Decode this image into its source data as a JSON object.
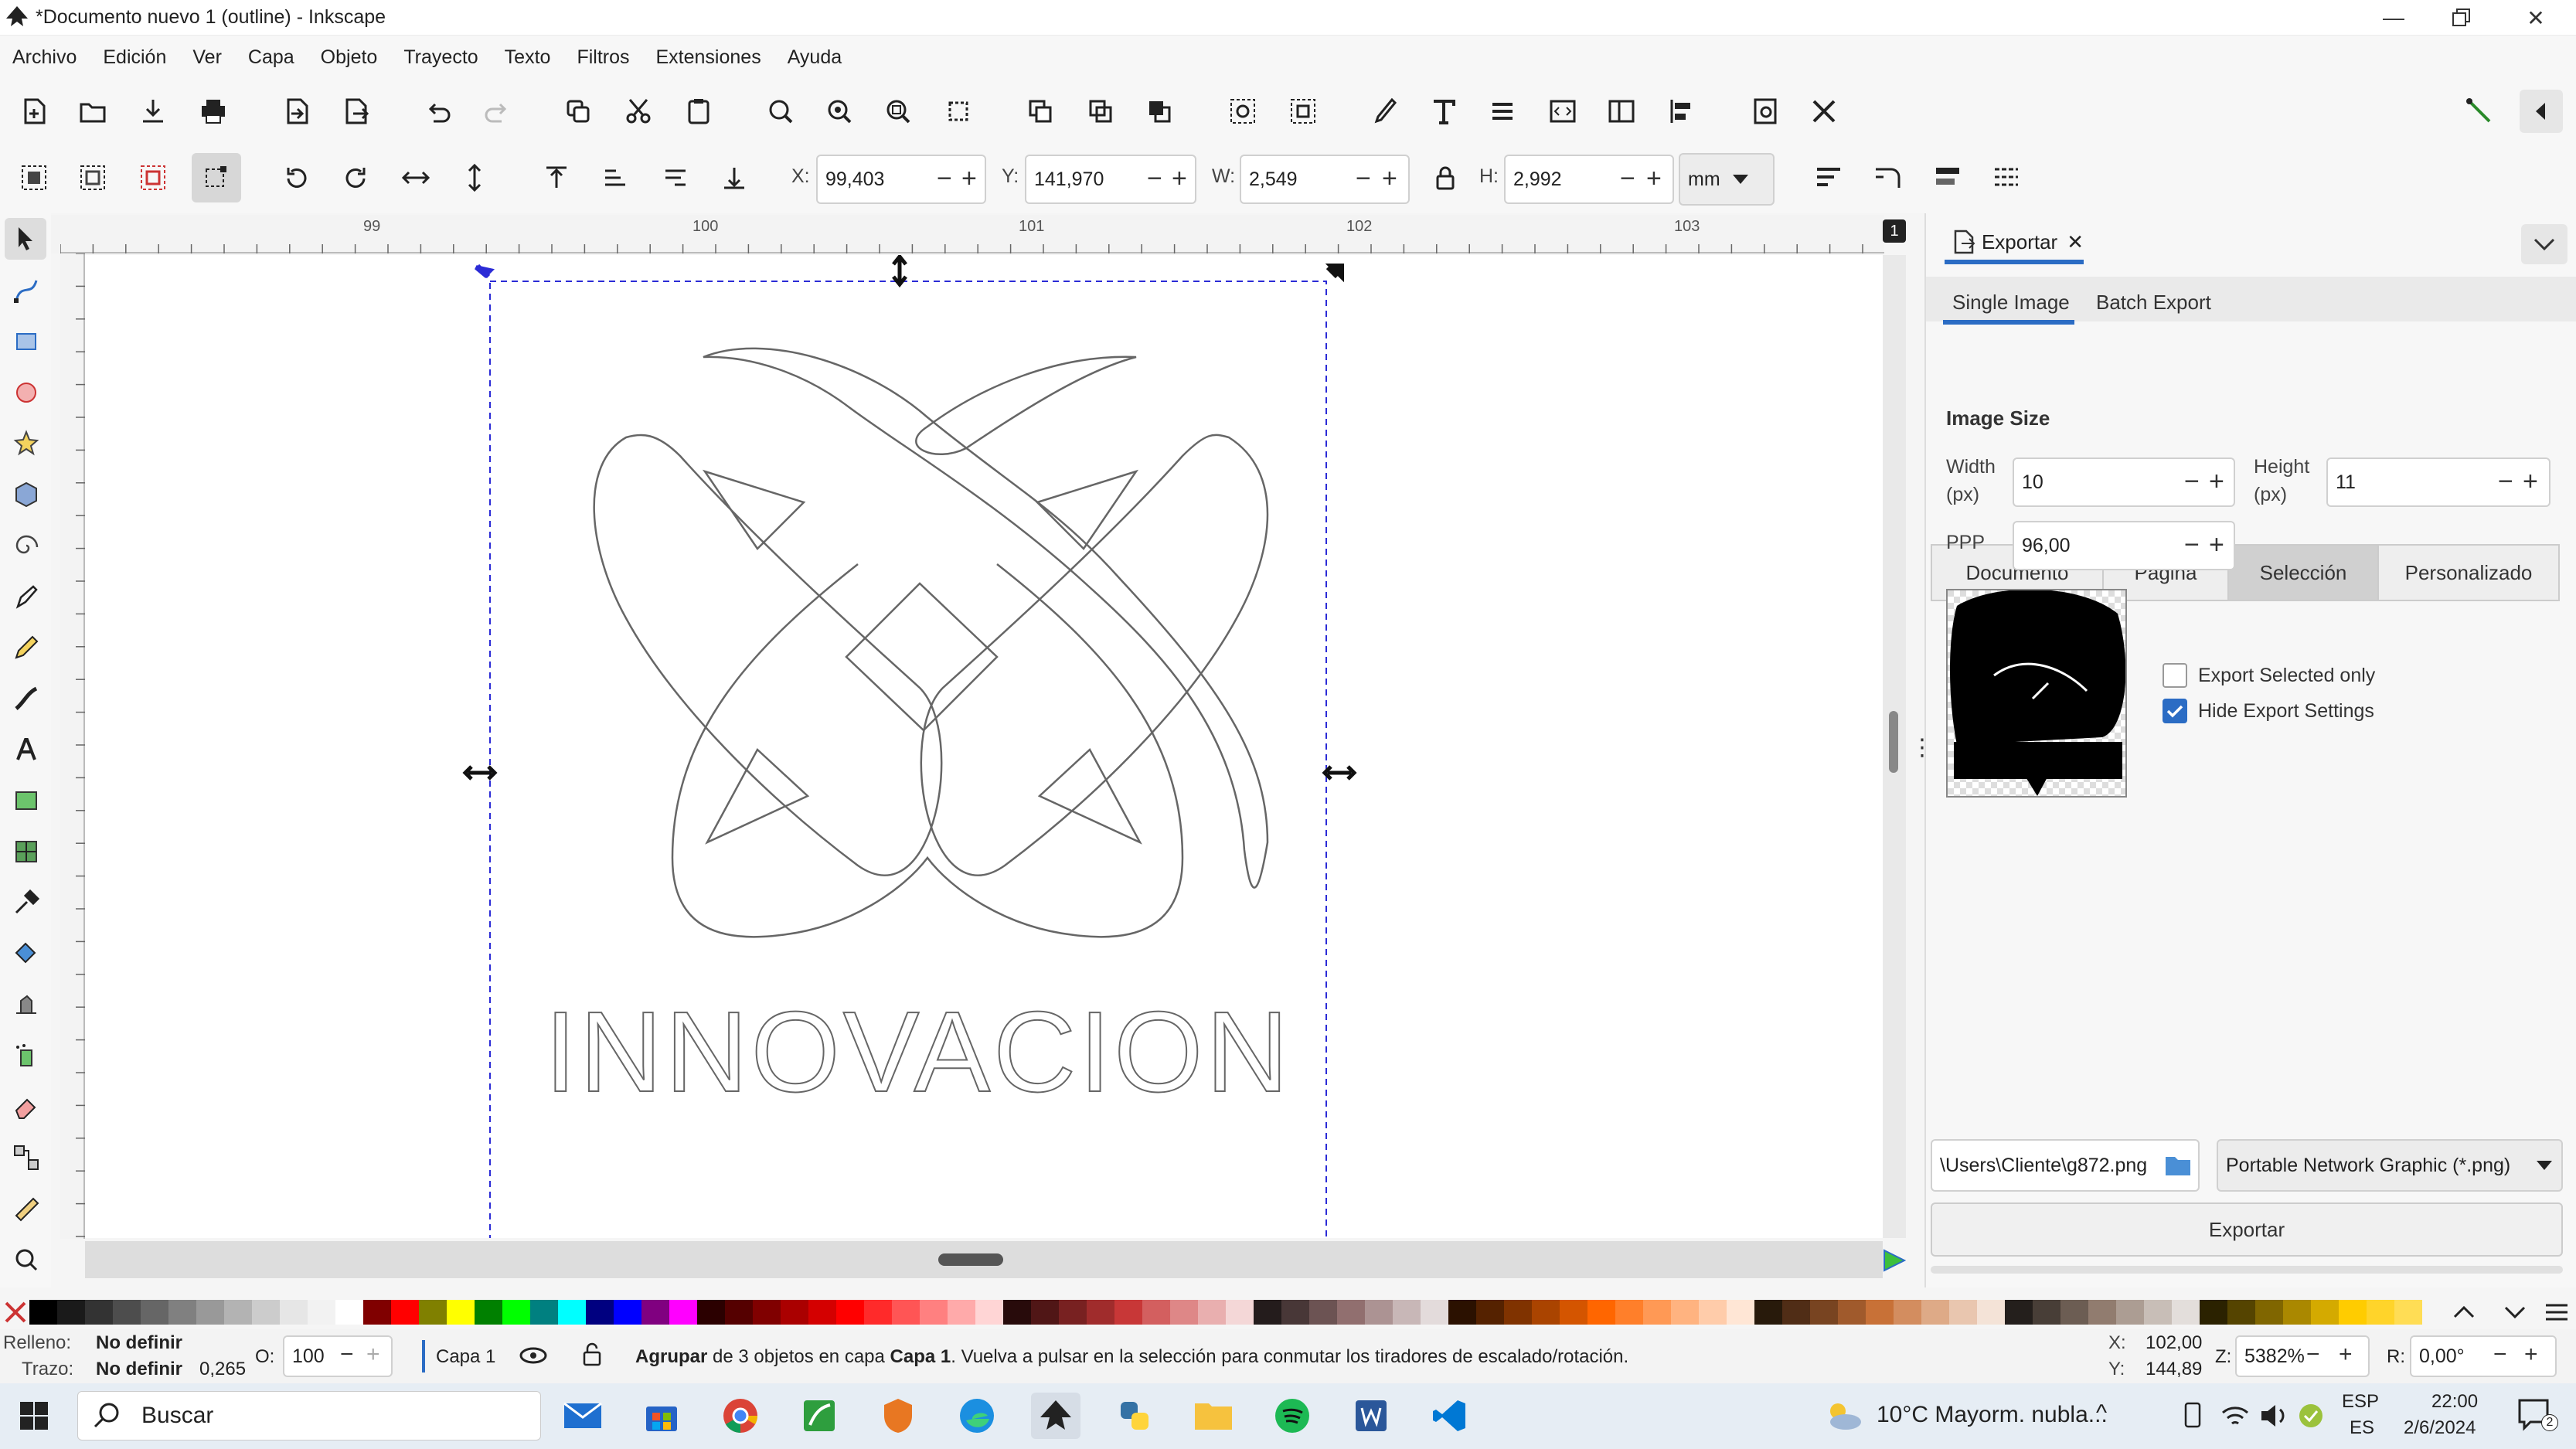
{
  "window": {
    "title": "*Documento nuevo 1 (outline) - Inkscape"
  },
  "menu": [
    "Archivo",
    "Edición",
    "Ver",
    "Capa",
    "Objeto",
    "Trayecto",
    "Texto",
    "Filtros",
    "Extensiones",
    "Ayuda"
  ],
  "coords": {
    "x_label": "X:",
    "x": "99,403",
    "y_label": "Y:",
    "y": "141,970",
    "w_label": "W:",
    "w": "2,549",
    "h_label": "H:",
    "h": "2,992",
    "unit": "mm"
  },
  "ruler": {
    "t1": "99",
    "t2": "100",
    "t3": "101",
    "t4": "102",
    "t5": "103",
    "layer_badge": "1"
  },
  "canvas": {
    "logo_text": "INNOVACION"
  },
  "export": {
    "tab_title": "Exportar",
    "subtab_single": "Single Image",
    "subtab_batch": "Batch Export",
    "area_buttons": [
      "Documento",
      "Página",
      "Selección",
      "Personalizado"
    ],
    "image_size": "Image Size",
    "width_label": "Width",
    "height_label": "Height",
    "px": "(px)",
    "width": "10",
    "height": "11",
    "ppp_label": "PPP",
    "ppp": "96,00",
    "export_selected_only": "Export Selected only",
    "hide_export_settings": "Hide Export Settings",
    "hide_checked": true,
    "path": "\\Users\\Cliente\\g872.png",
    "format": "Portable Network Graphic (*.png)",
    "export_button": "Exportar"
  },
  "status": {
    "fill_label": "Relleno:",
    "fill_value": "No definir",
    "stroke_label": "Trazo:",
    "stroke_value": "No definir",
    "stroke_width": "0,265",
    "opacity_label": "O:",
    "opacity": "100",
    "layer": "Capa 1",
    "msg_bold1": "Agrupar",
    "msg_1": " de 3 objetos en capa ",
    "msg_bold2": "Capa 1",
    "msg_2": ". Vuelva a pulsar en la selección para conmutar los tiradores de escalado/rotación.",
    "cx_label": "X:",
    "cx": "102,00",
    "cy_label": "Y:",
    "cy": "144,89",
    "zoom_label": "Z:",
    "zoom": "5382%",
    "rot_label": "R:",
    "rot": "0,00°"
  },
  "taskbar": {
    "search": "Buscar",
    "weather": "10°C  Mayorm. nubla...",
    "lang1": "ESP",
    "lang2": "ES",
    "time": "22:00",
    "date": "2/6/2024",
    "notif": "2"
  },
  "palette_colors": [
    "#000000",
    "#1a1a1a",
    "#333333",
    "#4d4d4d",
    "#666666",
    "#808080",
    "#999999",
    "#b3b3b3",
    "#cccccc",
    "#e6e6e6",
    "#f2f2f2",
    "#ffffff",
    "#800000",
    "#ff0000",
    "#808000",
    "#ffff00",
    "#008000",
    "#00ff00",
    "#008080",
    "#00ffff",
    "#000080",
    "#0000ff",
    "#800080",
    "#ff00ff",
    "#2b0000",
    "#550000",
    "#800000",
    "#aa0000",
    "#d40000",
    "#ff0000",
    "#ff2a2a",
    "#ff5555",
    "#ff8080",
    "#ffaaaa",
    "#ffd5d5",
    "#280b0b",
    "#501616",
    "#782121",
    "#a02c2c",
    "#c83737",
    "#d35f5f",
    "#de8787",
    "#e9afaf",
    "#f4d7d7",
    "#241c1c",
    "#483737",
    "#6c5353",
    "#916f6f",
    "#ac9393",
    "#c8b7b7",
    "#e3dbdb",
    "#2b1100",
    "#552200",
    "#803300",
    "#aa4400",
    "#d45500",
    "#ff6600",
    "#ff7f2a",
    "#ff9955",
    "#ffb380",
    "#ffccaa",
    "#ffe6d5",
    "#281a0b",
    "#502d16",
    "#784421",
    "#a05a2c",
    "#c87137",
    "#d38d5f",
    "#deaa87",
    "#e9c6af",
    "#f4e3d7",
    "#241f1c",
    "#483e37",
    "#6c5d53",
    "#917c6f",
    "#ac9d93",
    "#c8beb7",
    "#e3dedb",
    "#2b2200",
    "#554400",
    "#806600",
    "#aa8800",
    "#d4aa00",
    "#ffcc00",
    "#ffd42a",
    "#ffdd55"
  ]
}
